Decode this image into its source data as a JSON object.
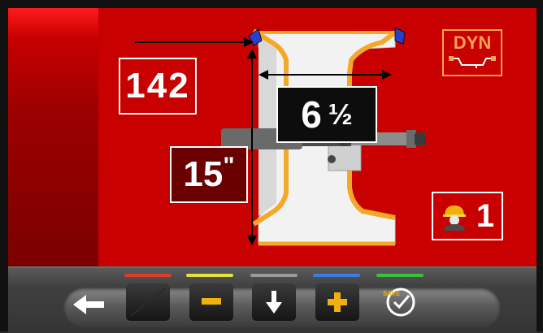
{
  "measurements": {
    "distance": "142",
    "width_whole": "6",
    "width_fraction": "½",
    "diameter": "15",
    "diameter_unit": "\""
  },
  "mode": {
    "label": "DYN"
  },
  "operator": {
    "number": "1"
  },
  "toolbar": {
    "led_colors": [
      "#e33b2a",
      "#e5e23c",
      "#9a9a9a",
      "#3a7de0",
      "#3bc03b"
    ],
    "save_label": "SAVE"
  },
  "colors": {
    "panel_red": "#c80000",
    "dark_red": "#7a0000",
    "rim_orange": "#f4a828",
    "yellow_icon": "#f0b010"
  }
}
